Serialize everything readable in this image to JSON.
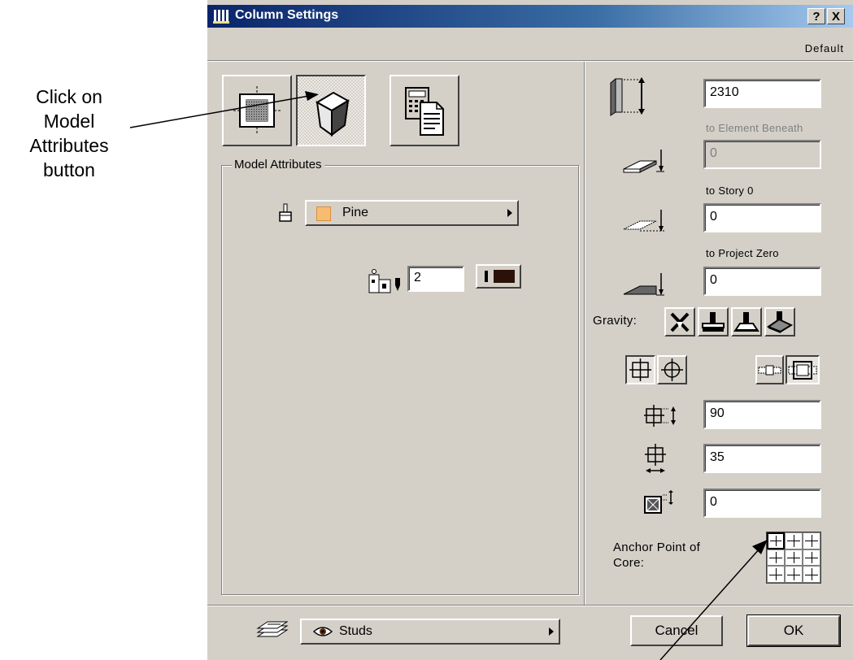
{
  "annotation": {
    "lines": [
      "Click on",
      "Model",
      "Attributes",
      "button"
    ]
  },
  "window": {
    "title": "Column Settings",
    "help_label": "?",
    "close_label": "X",
    "preset_label": "Default"
  },
  "tabs": [
    {
      "name": "floor-plan-tab",
      "icon": "floor-plan-icon"
    },
    {
      "name": "model-attributes-tab",
      "icon": "column-3d-icon",
      "selected": true
    },
    {
      "name": "listing-tab",
      "icon": "calculator-list-icon"
    }
  ],
  "model_attributes": {
    "group_label": "Model Attributes",
    "material": {
      "label": "Pine",
      "swatch_color": "#f8bc70"
    },
    "pen_number": "2"
  },
  "heights": {
    "height_value": "2310",
    "to_element_beneath_label": "to Element Beneath",
    "to_element_beneath_value": "0",
    "to_story_label": "to Story 0",
    "to_story_value": "0",
    "to_project_zero_label": "to Project Zero",
    "to_project_zero_value": "0"
  },
  "gravity": {
    "label": "Gravity:"
  },
  "dimensions": {
    "core_depth": "90",
    "core_width": "35",
    "veneer_thickness": "0"
  },
  "anchor": {
    "label_line1": "Anchor Point of",
    "label_line2": "Core:",
    "selected_index": 0
  },
  "footer": {
    "layer_label": "Studs",
    "cancel_label": "Cancel",
    "ok_label": "OK"
  }
}
